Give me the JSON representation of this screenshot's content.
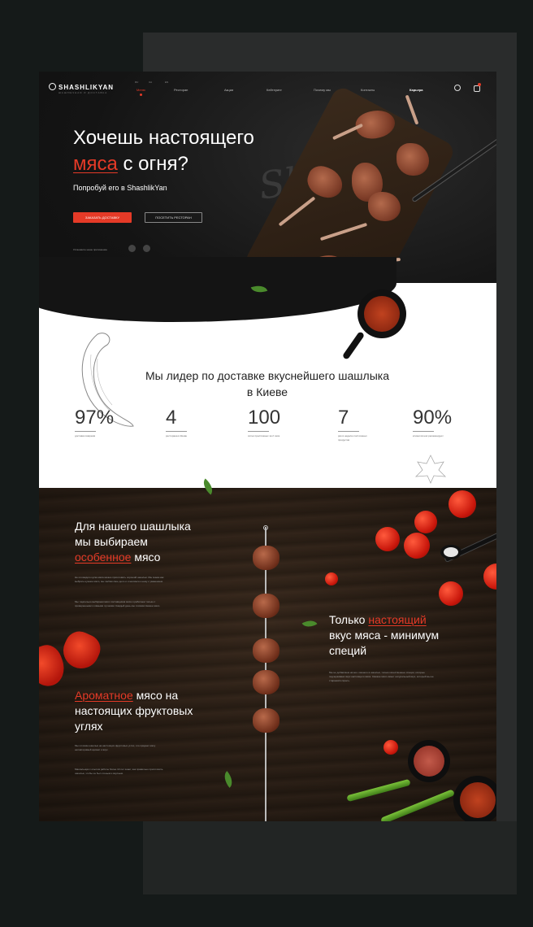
{
  "header": {
    "logo": "SHASHLIKYAN",
    "logo_sub": "ШАШЛЫЧНАЯ И ДОСТАВКА",
    "lang": [
      "RU",
      "UA",
      "EN"
    ],
    "nav": [
      "Меню",
      "Ресторан",
      "Акции",
      "Кейтеринг",
      "Почему мы",
      "Контакты",
      "Карьера"
    ]
  },
  "hero": {
    "title_line1": "Хочешь настоящего",
    "title_red": "мяса",
    "title_rest": "с огня?",
    "subtitle": "Попробуй его в ShashlikYan",
    "order_button": "ЗАКАЗАТЬ ДОСТАВКУ",
    "visit_button": "ПОСЕТИТЬ РЕСТОРАН",
    "app_text": "Установите наше приложение",
    "watermark": "Shashlik"
  },
  "stats": {
    "lead": "Мы лидер по доставке вкуснейшего шашлыка в Киеве",
    "items": [
      {
        "value": "97%",
        "label": "доставок вовремя"
      },
      {
        "value": "4",
        "label": "ресторана в Киеве"
      },
      {
        "value": "100",
        "label": "сотни престижных за 2 часа"
      },
      {
        "value": "7",
        "label": "раз в неделю постоянных продуктов"
      },
      {
        "value": "90%",
        "label": "клиентов нас рекомендуют"
      }
    ]
  },
  "wood": {
    "block1_line1": "Для нашего шашлыка",
    "block1_line2": "мы выбираем",
    "block1_red": "особенное",
    "block1_rest": "мясо",
    "block1_text": "Не из каждого куска мяса можно приготовить хороший шашлык. Мы знаем как выбрать нужное мясо, мы любим свое дело и относимся к нему с уважением.",
    "block1_text2": "Мы тщательно выбираем мясо поставщиков мяса и работаем только с проверенными и самыми лучшими. Каждый день мы готовим свежее мясо.",
    "block2_pre": "Только",
    "block2_red": "настоящий",
    "block2_line2": "вкус мяса - минимум",
    "block2_line3": "специй",
    "block2_text": "Мы не добавляем ничего лишнего в шашлык, только качественные специи, которые подчеркивают вкус настоящего мяса. Свежее мясо имеет натуральный вкус, который мы не стараемся скрыть.",
    "block3_red": "Ароматное",
    "block3_rest": "мясо на",
    "block3_line2": "настоящих фруктовых",
    "block3_line3": "углях",
    "block3_text": "Мы готовим шашлык на настоящих фруктовых углях, это придает мясу неповторимый аромат и вкус.",
    "block3_text2": "Мангальщик с опытом работы более 10 лет знает, как правильно приготовить шашлык, чтобы он был сочным и вкусным."
  },
  "colors": {
    "accent": "#e53a27",
    "dark": "#141414",
    "wood": "#3a2a1e"
  }
}
